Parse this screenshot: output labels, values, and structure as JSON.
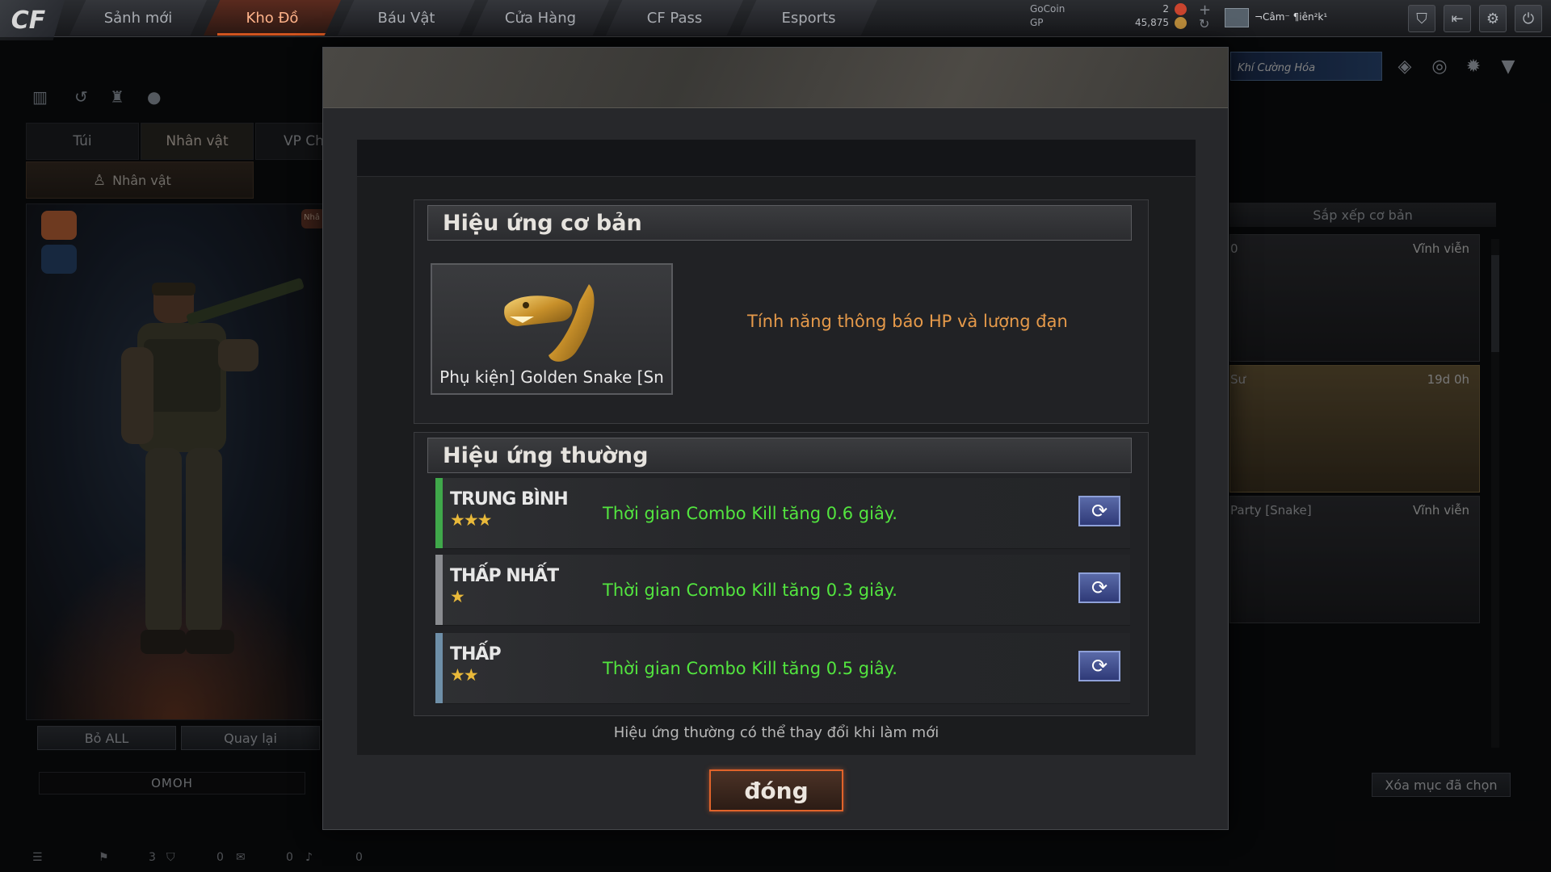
{
  "nav": {
    "logo": "CF",
    "tabs": [
      {
        "label": "Sảnh mới"
      },
      {
        "label": "Kho Đồ"
      },
      {
        "label": "Báu Vật"
      },
      {
        "label": "Cửa Hàng"
      },
      {
        "label": "CF Pass"
      },
      {
        "label": "Esports"
      }
    ],
    "active_tab": "Kho Đồ"
  },
  "currency": {
    "gocoin_label": "GoCoin",
    "gocoin_value": "2",
    "gp_label": "GP",
    "gp_value": "45,875"
  },
  "user": {
    "name": "¬Câm⁻ ¶iên²k¹"
  },
  "left_panel": {
    "tabs": [
      "Túi",
      "Nhân vật",
      "VP Chức"
    ],
    "active_tab": "Nhân vật",
    "subtab": "Nhân vật",
    "badge": "Nhâ",
    "btn_remove_all": "Bỏ ALL",
    "btn_back": "Quay lại",
    "player_name": "OMOH"
  },
  "right_panel": {
    "banner": "Khí Cường Hóa",
    "sort_label": "Sắp xếp cơ bản",
    "cards": [
      {
        "left": "0",
        "right": "Vĩnh viễn"
      },
      {
        "left": "Sư",
        "right": "19d 0h"
      },
      {
        "left": "Party [Snake]",
        "right": "Vĩnh viễn"
      }
    ],
    "clear_selected": "Xóa mục đã chọn"
  },
  "status_bar": {
    "values": [
      "3",
      "0",
      "0",
      "0"
    ]
  },
  "modal": {
    "basic_title": "Hiệu ứng cơ bản",
    "item_name": "Phụ kiện] Golden Snake [Sn",
    "basic_desc": "Tính năng thông báo HP và lượng đạn",
    "normal_title": "Hiệu ứng thường",
    "effects": [
      {
        "tier": "TRUNG BÌNH",
        "stars": "★★★",
        "desc": "Thời gian Combo Kill tăng 0.6 giây.",
        "bar_color": "#3fa84a"
      },
      {
        "tier": "THẤP NHẤT",
        "stars": "★",
        "desc": "Thời gian Combo Kill tăng 0.3 giây.",
        "bar_color": "#8a8c90"
      },
      {
        "tier": "THẤP",
        "stars": "★★",
        "desc": "Thời gian Combo Kill tăng 0.5 giây.",
        "bar_color": "#6e8fa8"
      }
    ],
    "note": "Hiệu ứng thường có thể thay đổi khi làm mới",
    "close_label": "đóng"
  }
}
